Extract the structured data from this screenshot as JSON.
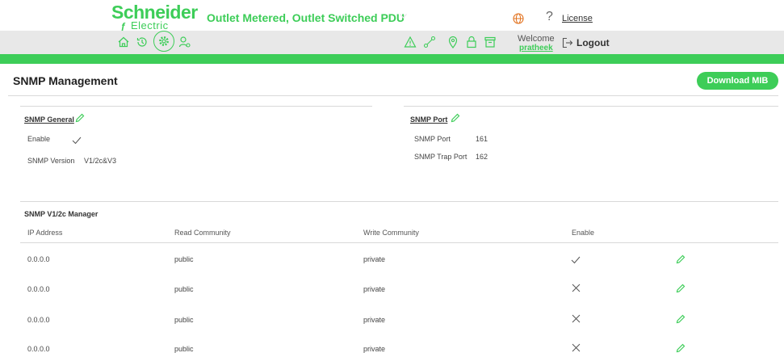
{
  "header": {
    "brand": "Schneider",
    "brand_sub": "Electric",
    "product_title": "Outlet Metered, Outlet Switched PDU",
    "license_label": "License",
    "welcome_label": "Welcome",
    "username": "pratheek",
    "logout_label": "Logout",
    "accent_color": "#3dcd58"
  },
  "nav": {
    "left_icons": [
      "home-icon",
      "history-icon",
      "settings-icon",
      "users-icon"
    ],
    "right_icons": [
      "alarm-icon",
      "network-icon",
      "location-icon",
      "lock-icon",
      "archive-icon"
    ],
    "active": "settings-icon"
  },
  "page": {
    "title": "SNMP Management",
    "download_label": "Download MIB"
  },
  "general": {
    "title": "SNMP General",
    "enable_label": "Enable",
    "enable_value": true,
    "version_label": "SNMP Version",
    "version_value": "V1/2c&V3"
  },
  "port": {
    "title": "SNMP Port",
    "port_label": "SNMP Port",
    "port_value": "161",
    "trap_label": "SNMP Trap Port",
    "trap_value": "162"
  },
  "manager": {
    "title": "SNMP V1/2c Manager",
    "columns": [
      "IP Address",
      "Read Community",
      "Write Community",
      "Enable"
    ],
    "rows": [
      {
        "ip": "0.0.0.0",
        "read": "public",
        "write": "private",
        "enabled": true
      },
      {
        "ip": "0.0.0.0",
        "read": "public",
        "write": "private",
        "enabled": false
      },
      {
        "ip": "0.0.0.0",
        "read": "public",
        "write": "private",
        "enabled": false
      },
      {
        "ip": "0.0.0.0",
        "read": "public",
        "write": "private",
        "enabled": false
      }
    ]
  }
}
